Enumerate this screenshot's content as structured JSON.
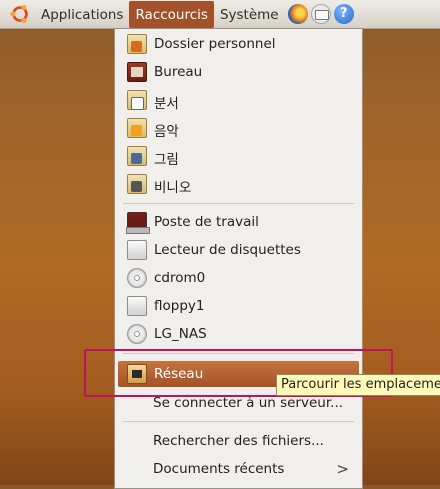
{
  "panel": {
    "menus": [
      "Applications",
      "Raccourcis",
      "Système"
    ],
    "active_menu": "Raccourcis",
    "launcher_icons": [
      "firefox-icon",
      "mail-icon",
      "help-icon"
    ],
    "help_glyph": "?"
  },
  "menu": {
    "items": [
      {
        "label": "Dossier personnel",
        "icon": "home-folder-icon"
      },
      {
        "label": "Bureau",
        "icon": "desktop-folder-icon"
      },
      {
        "label": "분서",
        "icon": "documents-folder-icon"
      },
      {
        "label": "음악",
        "icon": "music-folder-icon"
      },
      {
        "label": "그림",
        "icon": "pictures-folder-icon"
      },
      {
        "label": "비니오",
        "icon": "videos-folder-icon"
      },
      {
        "label": "Poste de travail",
        "icon": "computer-icon"
      },
      {
        "label": "Lecteur de disquettes",
        "icon": "floppy-drive-icon"
      },
      {
        "label": "cdrom0",
        "icon": "cdrom-icon"
      },
      {
        "label": "floppy1",
        "icon": "floppy-drive-icon"
      },
      {
        "label": "LG_NAS",
        "icon": "network-disc-icon"
      },
      {
        "label": "Réseau",
        "icon": "network-icon"
      },
      {
        "label": "Se connecter à un serveur..."
      },
      {
        "label": "Rechercher des fichiers..."
      },
      {
        "label": "Documents récents",
        "submenu_glyph": ">"
      }
    ],
    "selected_item": "Réseau"
  },
  "tooltip": {
    "text": "Parcourir les emplacemen"
  },
  "colors": {
    "accent": "#a2512b",
    "highlight_box": "#c0135c",
    "tooltip_bg": "#fff9b8"
  }
}
